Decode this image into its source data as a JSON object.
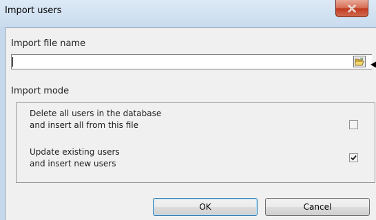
{
  "window": {
    "title": "Import users",
    "close_icon": "close-icon"
  },
  "file_section": {
    "label": "Import file name",
    "value": "",
    "browse_icon": "folder-open-icon"
  },
  "mode_section": {
    "label": "Import mode",
    "options": [
      {
        "line1": "Delete all users in the database",
        "line2": "and insert all from this file",
        "checked": false
      },
      {
        "line1": "Update existing users",
        "line2": "and insert new users",
        "checked": true
      }
    ]
  },
  "buttons": {
    "ok": "OK",
    "cancel": "Cancel"
  },
  "colors": {
    "title_bar": "#c9dbee",
    "close_button": "#c8472c",
    "client_area": "#f0f0f0",
    "default_button_border": "#3c7fb1"
  }
}
